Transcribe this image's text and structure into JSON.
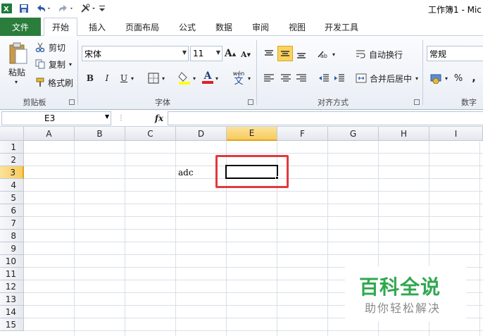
{
  "title": "工作簿1 - Mic",
  "tabs": {
    "file": "文件",
    "items": [
      "开始",
      "插入",
      "页面布局",
      "公式",
      "数据",
      "审阅",
      "视图",
      "开发工具"
    ]
  },
  "clipboard": {
    "paste": "粘贴",
    "cut": "剪切",
    "copy": "复制",
    "format_painter": "格式刷",
    "label": "剪贴板"
  },
  "font": {
    "name": "宋体",
    "size": "11",
    "bold": "B",
    "italic": "I",
    "underline": "U",
    "grow": "A",
    "shrink": "A",
    "color_letter": "A",
    "phonetic_top": "wén",
    "phonetic_bottom": "文",
    "label": "字体"
  },
  "alignment": {
    "wrap_text": "自动换行",
    "merge_center": "合并后居中",
    "label": "对齐方式"
  },
  "number": {
    "format": "常规",
    "percent": "%",
    "comma": ",",
    "label": "数字"
  },
  "formula_bar": {
    "name_box": "E3",
    "fx": "fx",
    "formula": ""
  },
  "columns": [
    "A",
    "B",
    "C",
    "D",
    "E",
    "F",
    "G",
    "H",
    "I"
  ],
  "rows": [
    "1",
    "2",
    "3",
    "4",
    "5",
    "6",
    "7",
    "8",
    "9",
    "10",
    "11",
    "12",
    "13",
    "14",
    "15"
  ],
  "cells": {
    "D3": "adc"
  },
  "selected_cell": "E3",
  "watermark": {
    "title": "百科全说",
    "subtitle": "助你轻松解决"
  },
  "colors": {
    "file_tab": "#2a7d3a",
    "highlight": "#e03a3e",
    "watermark_green": "#2fa84f"
  }
}
